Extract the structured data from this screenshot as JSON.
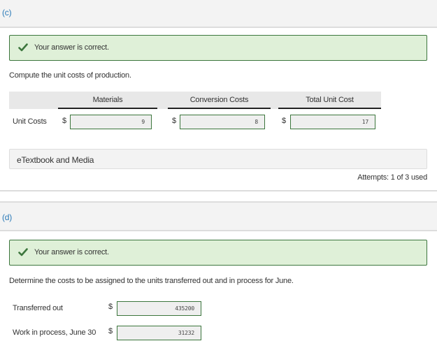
{
  "part_c": {
    "label": "(c)",
    "feedback": {
      "icon": "checkmark-icon",
      "message": "Your answer is correct.",
      "color": "#3c763d",
      "background": "#dff0d8"
    },
    "prompt": "Compute the unit costs of production.",
    "table": {
      "columns": [
        "Materials",
        "Conversion Costs",
        "Total Unit Cost"
      ],
      "rows": [
        {
          "label": "Unit Costs",
          "cells": [
            {
              "currency": "$",
              "value": "9"
            },
            {
              "currency": "$",
              "value": "8"
            },
            {
              "currency": "$",
              "value": "17"
            }
          ]
        }
      ]
    },
    "etextbook_label": "eTextbook and Media",
    "attempts": "Attempts: 1 of 3 used"
  },
  "part_d": {
    "label": "(d)",
    "feedback": {
      "icon": "checkmark-icon",
      "message": "Your answer is correct."
    },
    "prompt": "Determine the costs to be assigned to the units transferred out and in process for June.",
    "rows": [
      {
        "label": "Transferred out",
        "currency": "$",
        "value": "435200"
      },
      {
        "label": "Work in process, June 30",
        "currency": "$",
        "value": "31232"
      }
    ]
  }
}
